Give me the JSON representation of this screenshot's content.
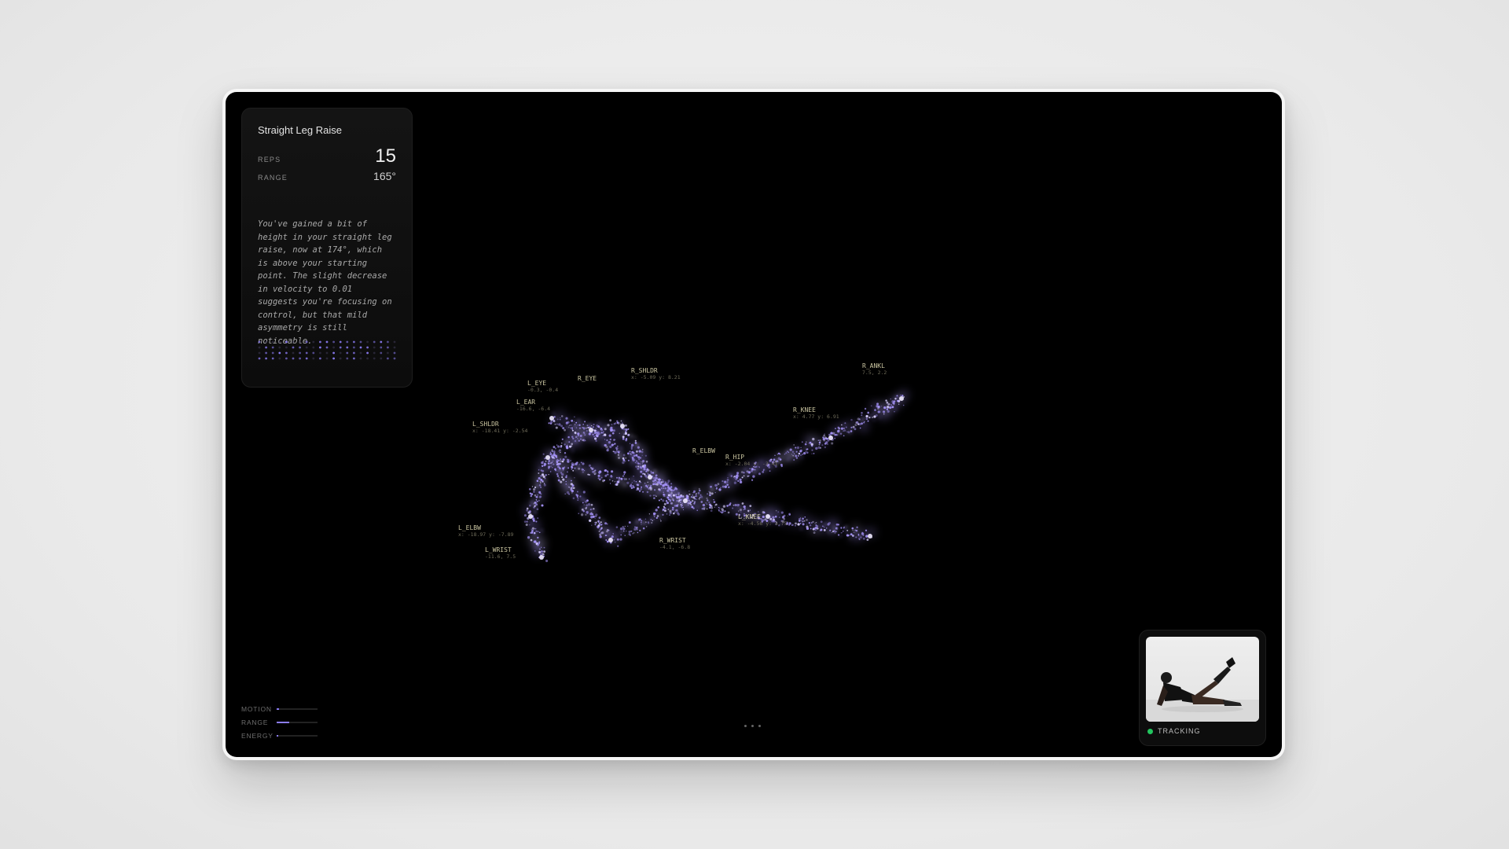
{
  "exercise": {
    "title": "Straight Leg Raise",
    "reps_label": "REPS",
    "reps_value": "15",
    "range_label": "RANGE",
    "range_value": "165°",
    "note": "You've gained a bit of height in your straight leg raise, now at 174°, which is above your starting point. The slight decrease in velocity to 0.01 suggests you're focusing on control, but that mild asymmetry is still noticeable."
  },
  "joints": [
    {
      "name": "L_EYE",
      "sub": "-0.3, -0.4"
    },
    {
      "name": "R_EYE",
      "sub": ""
    },
    {
      "name": "L_EAR",
      "sub": "-16.6, -6.4"
    },
    {
      "name": "L_SHLDR",
      "sub": "x: -18.41  y: -2.54"
    },
    {
      "name": "R_SHLDR",
      "sub": "x: -5.09  y: 8.21"
    },
    {
      "name": "R_ELBW",
      "sub": ""
    },
    {
      "name": "R_HIP",
      "sub": "x: -2.04  y: -3.41"
    },
    {
      "name": "R_KNEE",
      "sub": "x: 4.77  y: 6.91"
    },
    {
      "name": "R_ANKL",
      "sub": "7.5, 2.2"
    },
    {
      "name": "L_ELBW",
      "sub": "x: -18.97  y: -7.89"
    },
    {
      "name": "L_WRIST",
      "sub": "-11.6, 7.5"
    },
    {
      "name": "R_WRIST",
      "sub": "-4.1, -6.8"
    },
    {
      "name": "L_KNEE",
      "sub": "x: -4.56  y: 4.75"
    }
  ],
  "meters": [
    {
      "label": "MOTION",
      "level": 0.05
    },
    {
      "label": "RANGE",
      "level": 0.3
    },
    {
      "label": "ENERGY",
      "level": 0.04
    }
  ],
  "camera": {
    "status_label": "TRACKING",
    "status_color": "#22c55e"
  },
  "colors": {
    "accent": "#8b7cf5",
    "particle": "#a996ff"
  }
}
